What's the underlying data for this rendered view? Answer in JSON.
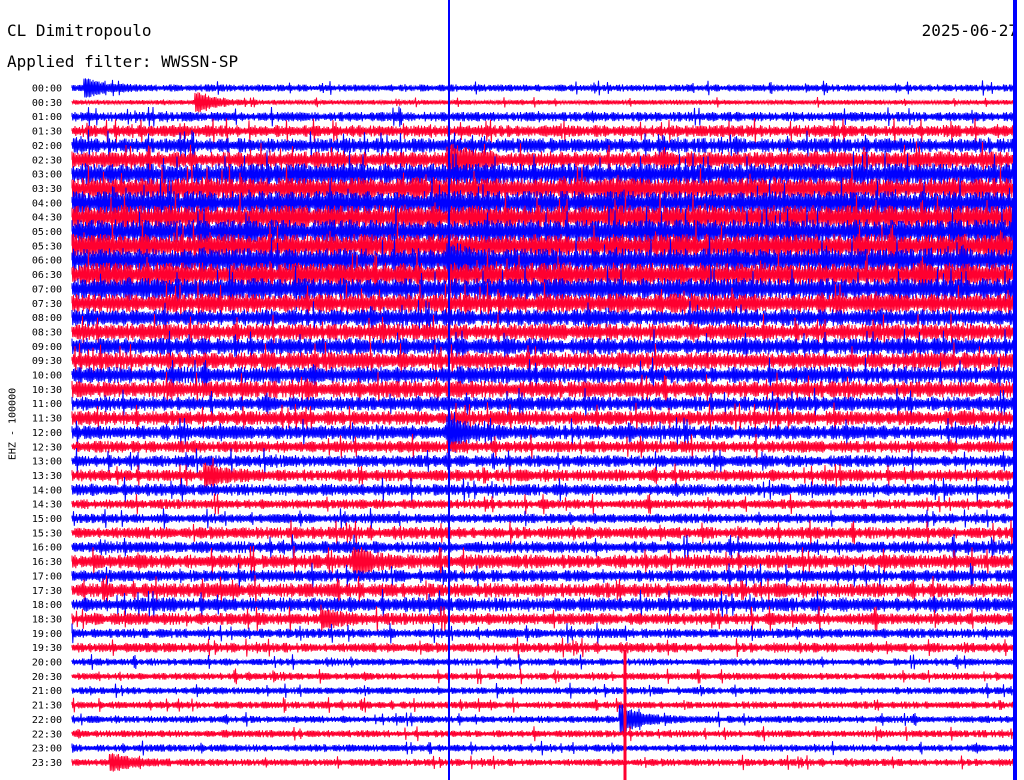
{
  "header": {
    "station": "CL Dimitropoulo",
    "date": "2025-06-27",
    "filter": "Applied filter: WWSSN-SP"
  },
  "chart_data": {
    "type": "line",
    "title": "CL Dimitropoulo",
    "ylabel": "EHZ - 100000",
    "row_labels": [
      "00:00",
      "00:30",
      "01:00",
      "01:30",
      "02:00",
      "02:30",
      "03:00",
      "03:30",
      "04:00",
      "04:30",
      "05:00",
      "05:30",
      "06:00",
      "06:30",
      "07:00",
      "07:30",
      "08:00",
      "08:30",
      "09:00",
      "09:30",
      "10:00",
      "10:30",
      "11:00",
      "11:30",
      "12:00",
      "12:30",
      "13:00",
      "13:30",
      "14:00",
      "14:30",
      "15:00",
      "15:30",
      "16:00",
      "16:30",
      "17:00",
      "17:30",
      "18:00",
      "18:30",
      "19:00",
      "19:30",
      "20:00",
      "20:30",
      "21:00",
      "21:30",
      "22:00",
      "22:30",
      "23:00",
      "23:30"
    ],
    "trace_colors": [
      "#0000ff",
      "#ff0030"
    ],
    "row_amplitude": [
      3,
      2,
      4,
      5,
      6,
      7,
      9,
      9,
      10,
      10,
      10,
      10,
      10,
      10,
      9,
      8,
      7,
      7,
      7,
      7,
      7,
      7,
      6,
      6,
      6,
      5,
      5,
      5,
      5,
      4,
      4,
      5,
      5,
      6,
      5,
      6,
      6,
      5,
      4,
      4,
      3,
      3,
      3,
      3,
      3,
      3,
      3,
      3
    ],
    "events": [
      {
        "row": 0,
        "label": "00:00",
        "minute": 0.5,
        "strength": 8
      },
      {
        "row": 1,
        "label": "00:30",
        "minute": 4,
        "strength": 10
      },
      {
        "row": 5,
        "label": "02:30",
        "minute": 12,
        "strength": 12
      },
      {
        "row": 12,
        "label": "06:00",
        "minute": 12,
        "strength": 10
      },
      {
        "row": 24,
        "label": "12:00",
        "minute": 12,
        "strength": 14
      },
      {
        "row": 27,
        "label": "13:30",
        "minute": 4.3,
        "strength": 8
      },
      {
        "row": 33,
        "label": "16:30",
        "minute": 9.0,
        "strength": 10
      },
      {
        "row": 37,
        "label": "18:30",
        "minute": 8.0,
        "strength": 7
      },
      {
        "row": 44,
        "label": "22:00",
        "minute": 17.5,
        "strength": 14
      },
      {
        "row": 47,
        "label": "23:30",
        "minute": 1.3,
        "strength": 8
      }
    ]
  }
}
